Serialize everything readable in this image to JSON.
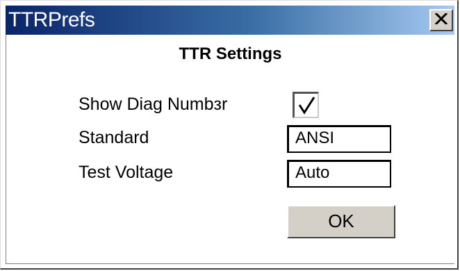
{
  "window": {
    "title": "TTRPrefs",
    "close_label": "X",
    "titlebar_colors": [
      "#0a246a",
      "#3a6ea5",
      "#a6caf0"
    ]
  },
  "dialog": {
    "heading": "TTR Settings",
    "show_diag": {
      "label": "Show Diag Numbзr",
      "checked": true
    },
    "standard": {
      "label": "Standard",
      "value": "ANSI"
    },
    "test_voltage": {
      "label": "Test Voltage",
      "value": "Auto"
    },
    "ok_label": "OK"
  }
}
